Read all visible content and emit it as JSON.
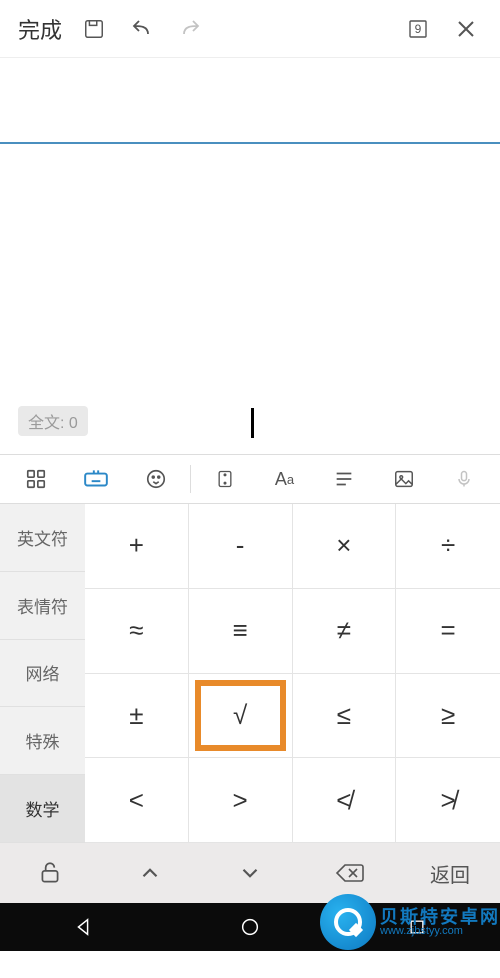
{
  "toolbar": {
    "done_label": "完成",
    "size_badge": "9"
  },
  "editor": {
    "counter_label": "全文: 0"
  },
  "categories": [
    "英文符",
    "表情符",
    "网络",
    "特殊",
    "数学"
  ],
  "active_category_index": 4,
  "keys": [
    "+",
    "-",
    "×",
    "÷",
    "≈",
    "≡",
    "≠",
    "=",
    "±",
    "√",
    "≤",
    "≥",
    "<",
    ">",
    "≮",
    "≯"
  ],
  "highlight_key_index": 9,
  "bottom": {
    "return_label": "返回"
  },
  "watermark": {
    "line1": "贝斯特安卓网",
    "line2": "www.zjbstyy.com"
  }
}
